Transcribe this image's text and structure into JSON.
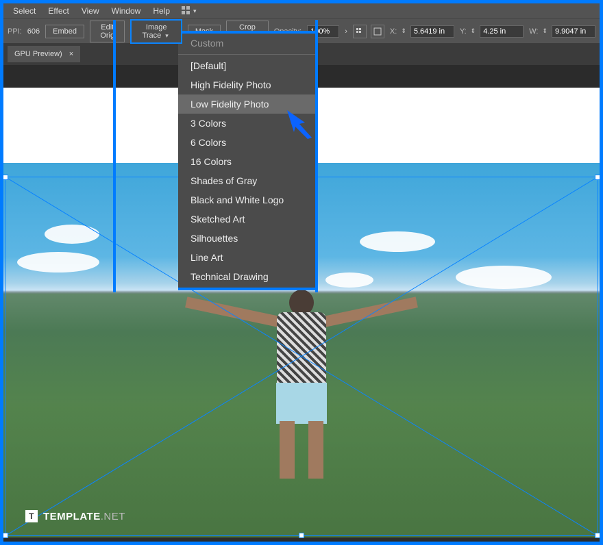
{
  "menu": {
    "items": [
      "Select",
      "Effect",
      "View",
      "Window",
      "Help"
    ]
  },
  "options_bar": {
    "ppi_label": "PPI:",
    "ppi_value": "606",
    "embed": "Embed",
    "edit_original": "Edit Orig",
    "image_trace": "Image Trace",
    "mask": "Mask",
    "crop": "Crop Image",
    "opacity_label": "Opacity:",
    "opacity_value": "100%",
    "x_label": "X:",
    "x_value": "5.6419 in",
    "y_label": "Y:",
    "y_value": "4.25 in",
    "w_label": "W:",
    "w_value": "9.9047 in"
  },
  "doc_tab": {
    "title": "GPU Preview)",
    "close": "×"
  },
  "trace_menu": {
    "custom": "Custom",
    "items": [
      "[Default]",
      "High Fidelity Photo",
      "Low Fidelity Photo",
      "3 Colors",
      "6 Colors",
      "16 Colors",
      "Shades of Gray",
      "Black and White Logo",
      "Sketched Art",
      "Silhouettes",
      "Line Art",
      "Technical Drawing"
    ],
    "hover_index": 2
  },
  "watermark": {
    "logo": "T",
    "brand": "TEMPLATE",
    "suffix": ".NET"
  }
}
